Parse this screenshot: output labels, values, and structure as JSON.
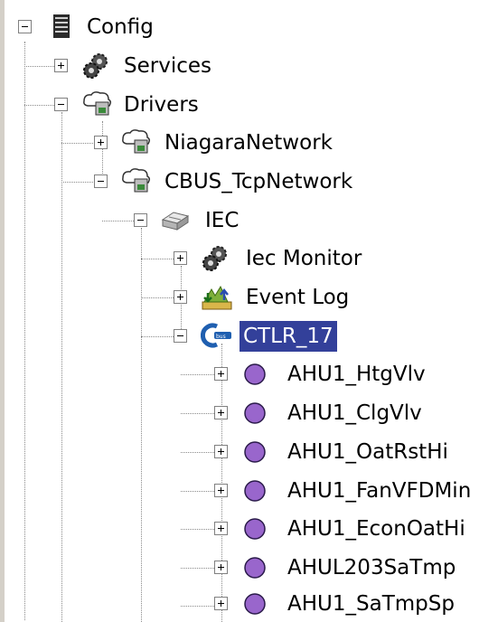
{
  "tree": {
    "config": {
      "label": "Config",
      "icon": "config-server-icon",
      "expanded": true
    },
    "services": {
      "label": "Services",
      "icon": "gears-icon",
      "expanded": false
    },
    "drivers": {
      "label": "Drivers",
      "icon": "network-folder-icon",
      "expanded": true
    },
    "niagara_network": {
      "label": "NiagaraNetwork",
      "icon": "network-folder-icon",
      "expanded": false
    },
    "cbus_network": {
      "label": "CBUS_TcpNetwork",
      "icon": "network-folder-icon",
      "expanded": true
    },
    "iec": {
      "label": "IEC",
      "icon": "device-icon",
      "expanded": true
    },
    "iec_monitor": {
      "label": "Iec Monitor",
      "icon": "gears-icon",
      "expanded": false
    },
    "event_log": {
      "label": "Event Log",
      "icon": "event-log-icon",
      "expanded": false
    },
    "ctlr": {
      "label": "CTLR_17",
      "icon": "cbus-controller-icon",
      "expanded": true,
      "selected": true
    },
    "points": [
      {
        "label": "AHU1_HtgVlv",
        "icon": "purple-point-icon"
      },
      {
        "label": "AHU1_ClgVlv",
        "icon": "purple-point-icon"
      },
      {
        "label": "AHU1_OatRstHi",
        "icon": "purple-point-icon"
      },
      {
        "label": "AHU1_FanVFDMin",
        "icon": "purple-point-icon"
      },
      {
        "label": "AHU1_EconOatHi",
        "icon": "purple-point-icon"
      },
      {
        "label": "AHUL203SaTmp",
        "icon": "purple-point-icon"
      },
      {
        "label": "AHU1_SaTmpSp",
        "icon": "purple-point-icon"
      }
    ],
    "colors": {
      "selection": "#33409a",
      "point": "#9966cc"
    }
  }
}
